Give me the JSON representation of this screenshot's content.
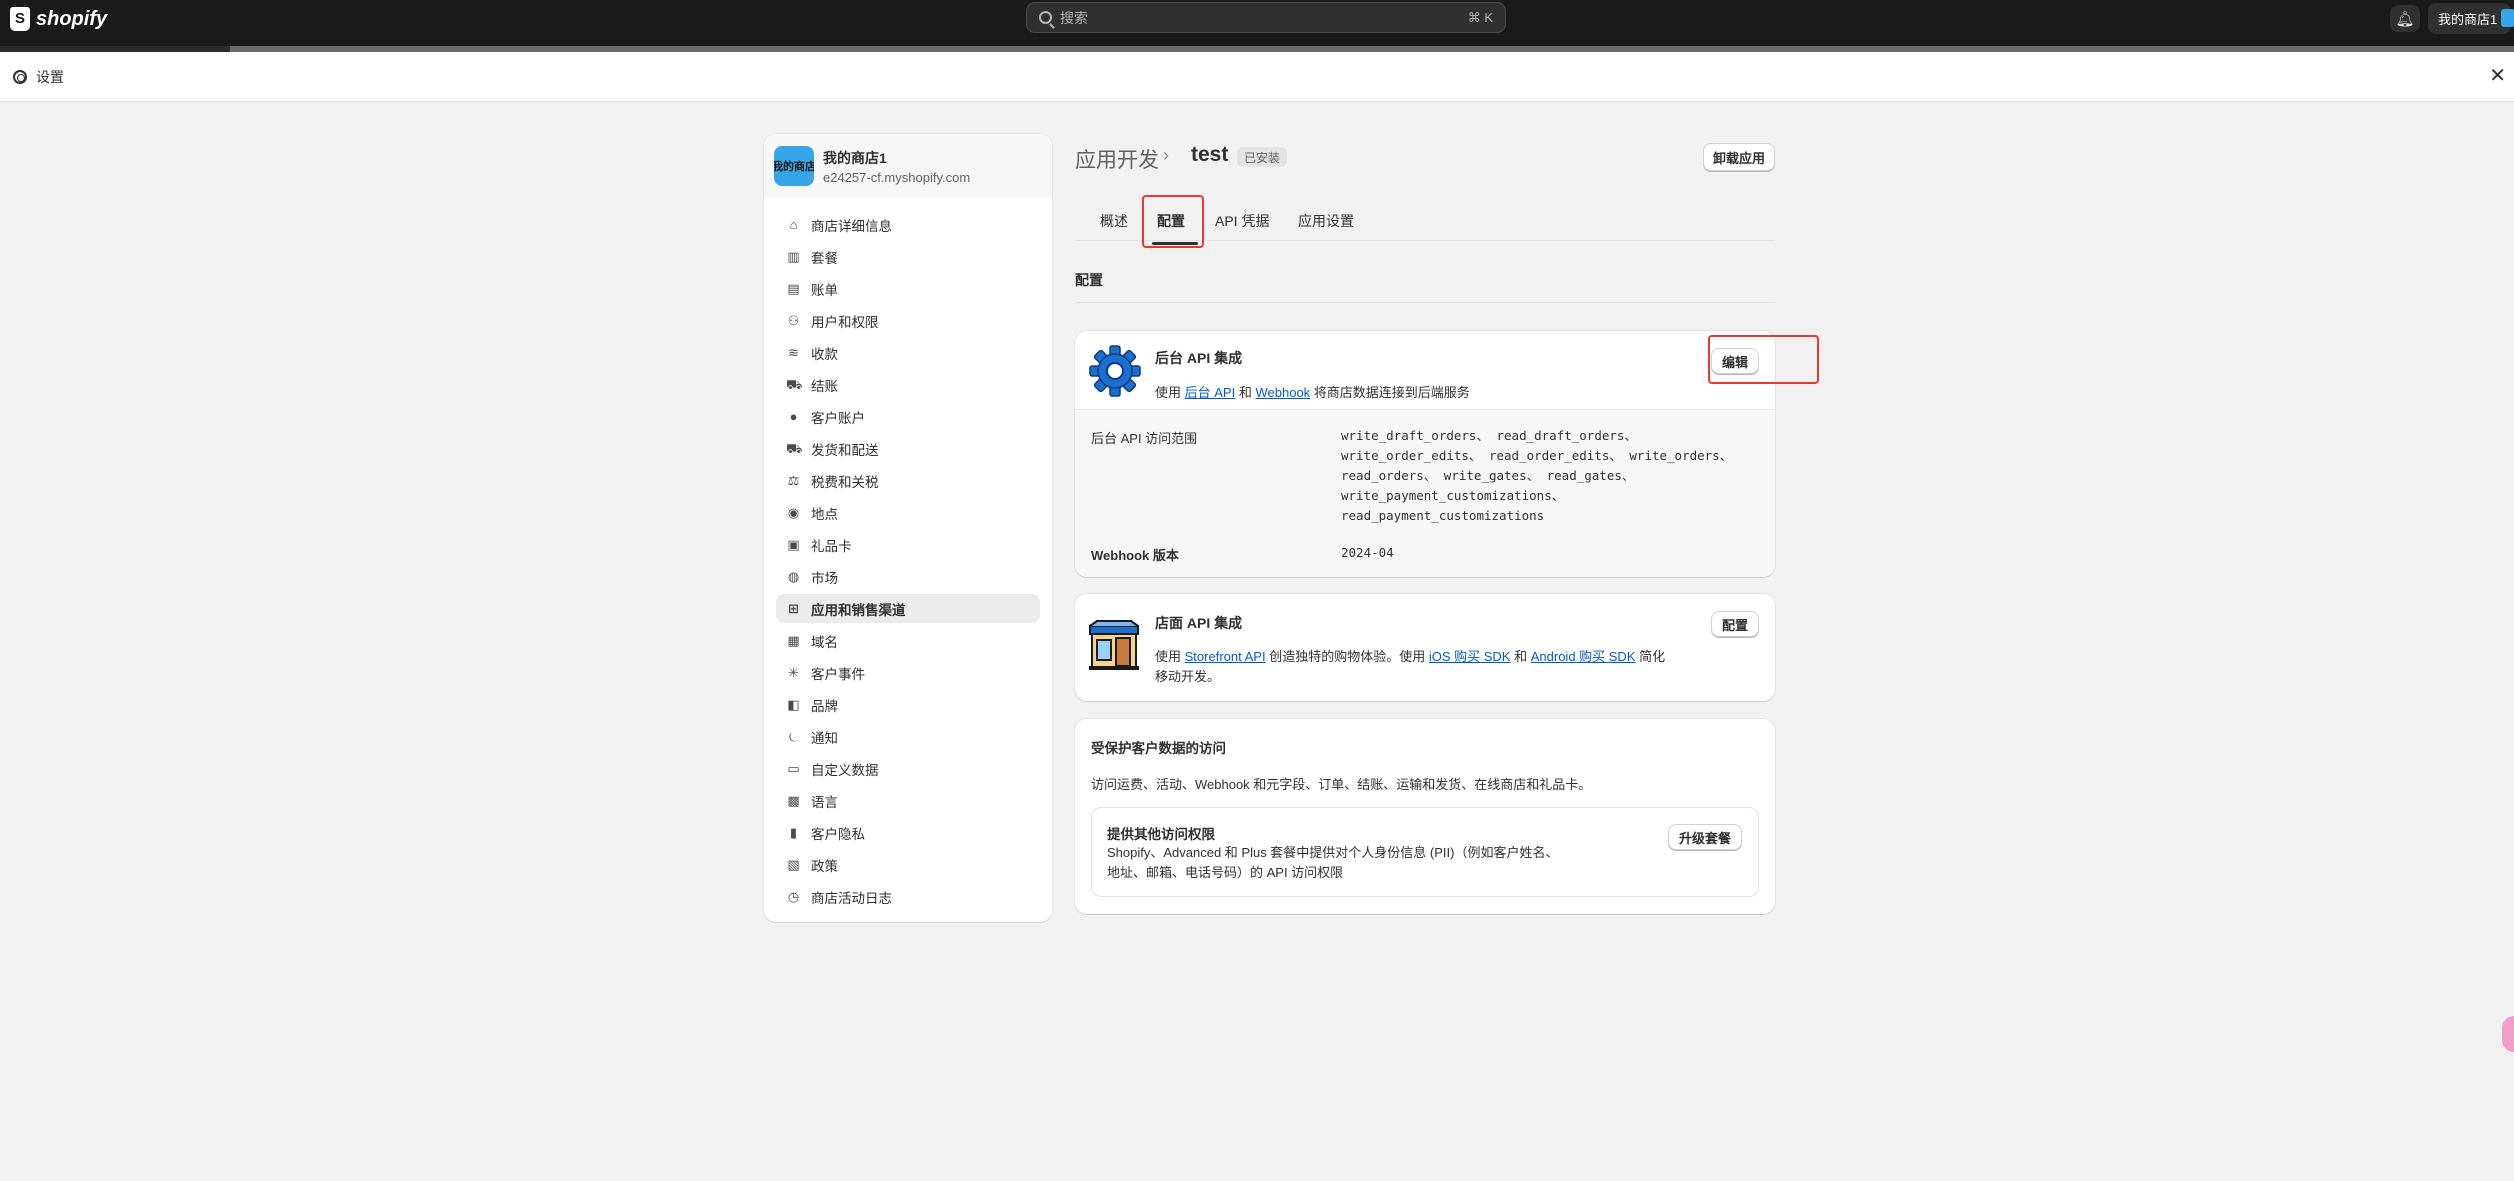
{
  "topbar": {
    "brand": "shopify",
    "search_placeholder": "搜索",
    "search_shortcut": "⌘ K",
    "store_label": "我的商店1"
  },
  "settings": {
    "title": "设置"
  },
  "sidebar": {
    "store_name": "我的商店1",
    "store_domain": "e24257-cf.myshopify.com",
    "store_avatar_text": "我的商店",
    "items": [
      {
        "label": "商店详细信息",
        "icon": "store-icon"
      },
      {
        "label": "套餐",
        "icon": "plan-icon"
      },
      {
        "label": "账单",
        "icon": "billing-icon"
      },
      {
        "label": "用户和权限",
        "icon": "users-icon"
      },
      {
        "label": "收款",
        "icon": "payments-icon"
      },
      {
        "label": "结账",
        "icon": "cart-icon"
      },
      {
        "label": "客户账户",
        "icon": "person-icon"
      },
      {
        "label": "发货和配送",
        "icon": "truck-icon"
      },
      {
        "label": "税费和关税",
        "icon": "tax-icon"
      },
      {
        "label": "地点",
        "icon": "location-icon"
      },
      {
        "label": "礼品卡",
        "icon": "gift-card-icon"
      },
      {
        "label": "市场",
        "icon": "globe-icon"
      },
      {
        "label": "应用和销售渠道",
        "icon": "apps-icon"
      },
      {
        "label": "域名",
        "icon": "domain-icon"
      },
      {
        "label": "客户事件",
        "icon": "events-icon"
      },
      {
        "label": "品牌",
        "icon": "brand-icon"
      },
      {
        "label": "通知",
        "icon": "bell-icon"
      },
      {
        "label": "自定义数据",
        "icon": "data-icon"
      },
      {
        "label": "语言",
        "icon": "language-icon"
      },
      {
        "label": "客户隐私",
        "icon": "lock-icon"
      },
      {
        "label": "政策",
        "icon": "policy-icon"
      },
      {
        "label": "商店活动日志",
        "icon": "log-icon"
      }
    ],
    "active_index": 12
  },
  "main": {
    "breadcrumb_root": "应用开发",
    "app_title": "test",
    "status_badge": "已安装",
    "uninstall_label": "卸载应用",
    "tabs": [
      "概述",
      "配置",
      "API 凭据",
      "应用设置"
    ],
    "active_tab": 1,
    "section_title": "配置",
    "admin_card": {
      "title": "后台 API 集成",
      "desc_prefix": "使用",
      "link1": "后台 API",
      "desc_and": "和",
      "link2": "Webhook",
      "desc_suffix": "将商店数据连接到后端服务",
      "edit_label": "编辑",
      "scopes_label": "后台 API 访问范围",
      "scopes_lines": [
        "write_draft_orders、 read_draft_orders、",
        "write_order_edits、 read_order_edits、 write_orders、",
        "read_orders、 write_gates、 read_gates、",
        "write_payment_customizations、",
        "read_payment_customizations"
      ],
      "webhook_label": "Webhook 版本",
      "webhook_version": "2024-04"
    },
    "storefront_card": {
      "title": "店面 API 集成",
      "configure_label": "配置",
      "desc_prefix": "使用",
      "link1": "Storefront API",
      "desc_mid": "创造独特的购物体验。使用",
      "link2": "iOS 购买 SDK",
      "desc_and": "和",
      "link3": "Android 购买 SDK",
      "desc_suffix": "简化",
      "desc_line2": "移动开发。"
    },
    "protected_card": {
      "title": "受保护客户数据的访问",
      "desc": "访问运费、活动、Webhook 和元字段、订单、结账、运输和发货、在线商店和礼品卡。",
      "box_title": "提供其他访问权限",
      "box_line1": "Shopify、Advanced 和 Plus 套餐中提供对个人身份信息 (PII)（例如客户姓名、",
      "box_line2": "地址、邮箱、电话号码）的 API 访问权限",
      "upgrade_label": "升级套餐"
    }
  },
  "colors": {
    "topbar": "#1a1a1a",
    "avatar": "#37a6e8",
    "link": "#005bd3",
    "highlight": "#e53935"
  }
}
